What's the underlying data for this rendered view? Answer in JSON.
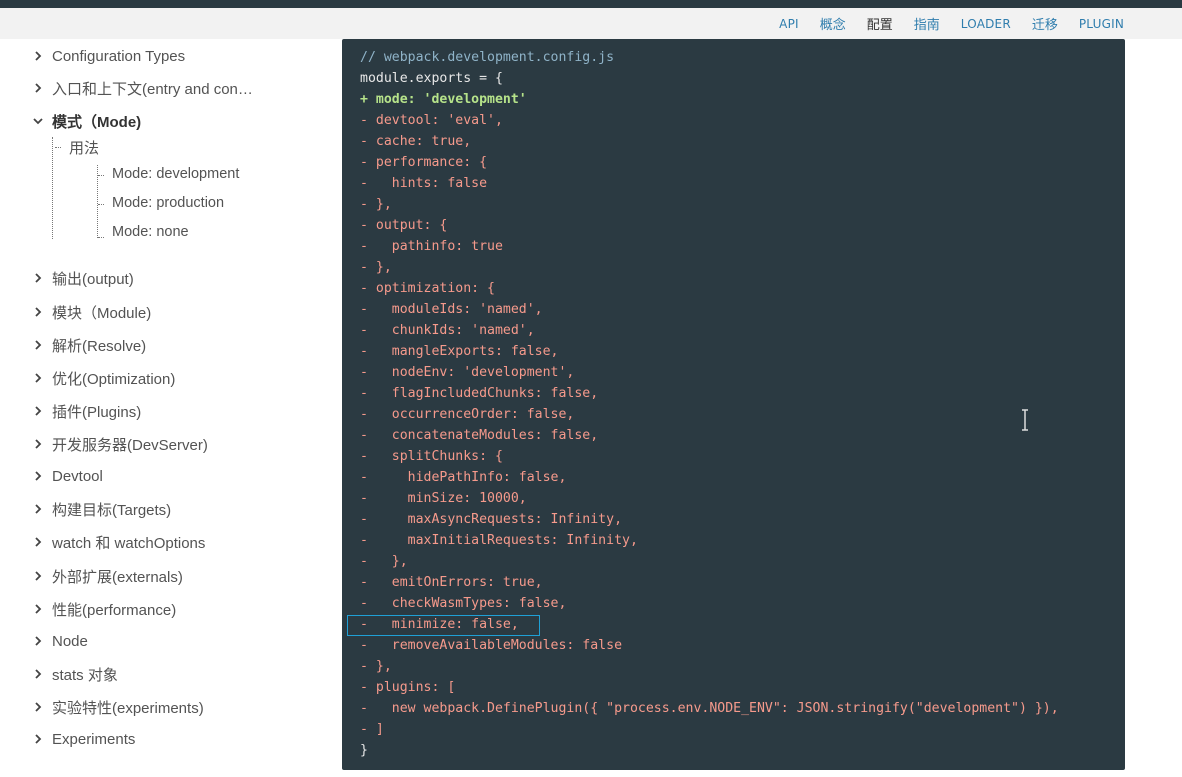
{
  "nav": {
    "links": [
      {
        "label": "API"
      },
      {
        "label": "概念"
      },
      {
        "label": "配置",
        "active": true
      },
      {
        "label": "指南"
      },
      {
        "label": "LOADER"
      },
      {
        "label": "迁移"
      },
      {
        "label": "PLUGIN"
      }
    ]
  },
  "sidebar": {
    "items": [
      {
        "label": "Configuration Types"
      },
      {
        "label": "入口和上下文(entry and con…"
      },
      {
        "label": "模式（Mode)",
        "expanded": true
      },
      {
        "label": "输出(output)"
      },
      {
        "label": "模块（Module)"
      },
      {
        "label": "解析(Resolve)"
      },
      {
        "label": "优化(Optimization)"
      },
      {
        "label": "插件(Plugins)"
      },
      {
        "label": "开发服务器(DevServer)"
      },
      {
        "label": "Devtool"
      },
      {
        "label": "构建目标(Targets)"
      },
      {
        "label": "watch 和 watchOptions"
      },
      {
        "label": "外部扩展(externals)"
      },
      {
        "label": "性能(performance)"
      },
      {
        "label": "Node"
      },
      {
        "label": "stats 对象"
      },
      {
        "label": "实验特性(experiments)"
      },
      {
        "label": "Experiments"
      }
    ],
    "sub": {
      "label": "用法",
      "children": [
        {
          "label": "Mode: development"
        },
        {
          "label": "Mode: production"
        },
        {
          "label": "Mode: none"
        }
      ]
    }
  },
  "code": {
    "lines": [
      {
        "type": "comment",
        "text": "// webpack.development.config.js"
      },
      {
        "type": "plain",
        "text": "module.exports = {"
      },
      {
        "type": "added",
        "text": "+ mode: 'development'"
      },
      {
        "type": "removed",
        "text": "- devtool: 'eval',"
      },
      {
        "type": "removed",
        "text": "- cache: true,"
      },
      {
        "type": "removed",
        "text": "- performance: {"
      },
      {
        "type": "removed",
        "text": "-   hints: false"
      },
      {
        "type": "removed",
        "text": "- },"
      },
      {
        "type": "removed",
        "text": "- output: {"
      },
      {
        "type": "removed",
        "text": "-   pathinfo: true"
      },
      {
        "type": "removed",
        "text": "- },"
      },
      {
        "type": "removed",
        "text": "- optimization: {"
      },
      {
        "type": "removed",
        "text": "-   moduleIds: 'named',"
      },
      {
        "type": "removed",
        "text": "-   chunkIds: 'named',"
      },
      {
        "type": "removed",
        "text": "-   mangleExports: false,"
      },
      {
        "type": "removed",
        "text": "-   nodeEnv: 'development',"
      },
      {
        "type": "removed",
        "text": "-   flagIncludedChunks: false,"
      },
      {
        "type": "removed",
        "text": "-   occurrenceOrder: false,"
      },
      {
        "type": "removed",
        "text": "-   concatenateModules: false,"
      },
      {
        "type": "removed",
        "text": "-   splitChunks: {"
      },
      {
        "type": "removed",
        "text": "-     hidePathInfo: false,"
      },
      {
        "type": "removed",
        "text": "-     minSize: 10000,"
      },
      {
        "type": "removed",
        "text": "-     maxAsyncRequests: Infinity,"
      },
      {
        "type": "removed",
        "text": "-     maxInitialRequests: Infinity,"
      },
      {
        "type": "removed",
        "text": "-   },"
      },
      {
        "type": "removed",
        "text": "-   emitOnErrors: true,"
      },
      {
        "type": "removed",
        "text": "-   checkWasmTypes: false,"
      },
      {
        "type": "removed",
        "text": "-   minimize: false,"
      },
      {
        "type": "removed",
        "text": "-   removeAvailableModules: false"
      },
      {
        "type": "removed",
        "text": "- },"
      },
      {
        "type": "removed",
        "text": "- plugins: ["
      },
      {
        "type": "removed",
        "text": "-   new webpack.DefinePlugin({ \"process.env.NODE_ENV\": JSON.stringify(\"development\") }),"
      },
      {
        "type": "removed",
        "text": "- ]"
      },
      {
        "type": "plain",
        "text": "}"
      }
    ]
  },
  "colors": {
    "code_bg": "#2b3a42",
    "removed": "#f69a8c",
    "added": "#b6e38a",
    "link": "#2f7dad",
    "highlight": "#1fa0d6"
  }
}
